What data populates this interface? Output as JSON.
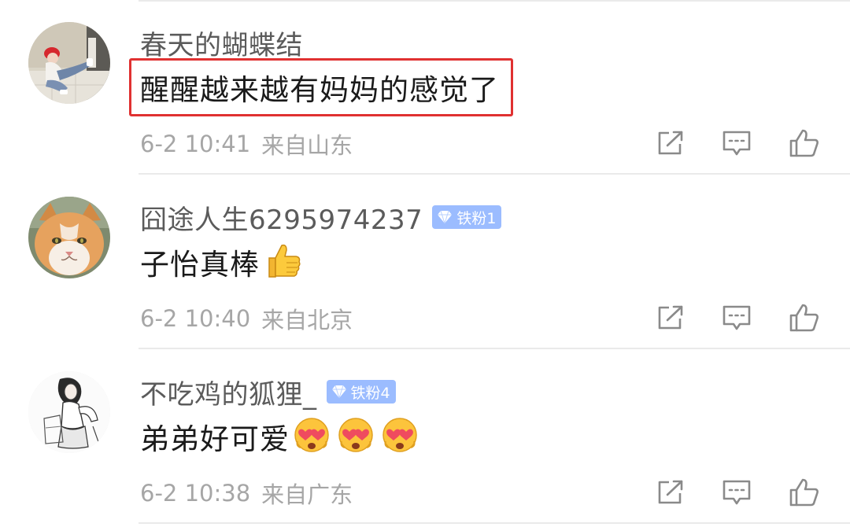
{
  "comments": [
    {
      "username": "春天的蝴蝶结",
      "badge": "",
      "content": "醒醒越来越有妈妈的感觉了",
      "emoji": [],
      "date": "6-2 10:41",
      "location": "来自山东",
      "highlighted": true,
      "avatar_icon": "avatar-girl-photo"
    },
    {
      "username": "囧途人生6295974237",
      "badge": "铁粉1",
      "content": "子怡真棒",
      "emoji": [
        "thumbs-up"
      ],
      "date": "6-2 10:40",
      "location": "来自北京",
      "highlighted": false,
      "avatar_icon": "avatar-cat-photo"
    },
    {
      "username": "不吃鸡的狐狸_",
      "badge": "铁粉4",
      "content": "弟弟好可爱",
      "emoji": [
        "heart-eyes",
        "heart-eyes",
        "heart-eyes"
      ],
      "date": "6-2 10:38",
      "location": "来自广东",
      "highlighted": false,
      "avatar_icon": "avatar-sketch-girl"
    }
  ],
  "icons": {
    "share": "share-icon",
    "reply": "comment-icon",
    "like": "thumbs-up-outline-icon",
    "badge": "diamond-icon"
  },
  "colors": {
    "highlight_border": "#e03131",
    "badge_bg": "#9bbcff",
    "username": "#5b5b5b",
    "meta": "#a6a6a6",
    "icon": "#8a8a8a"
  }
}
